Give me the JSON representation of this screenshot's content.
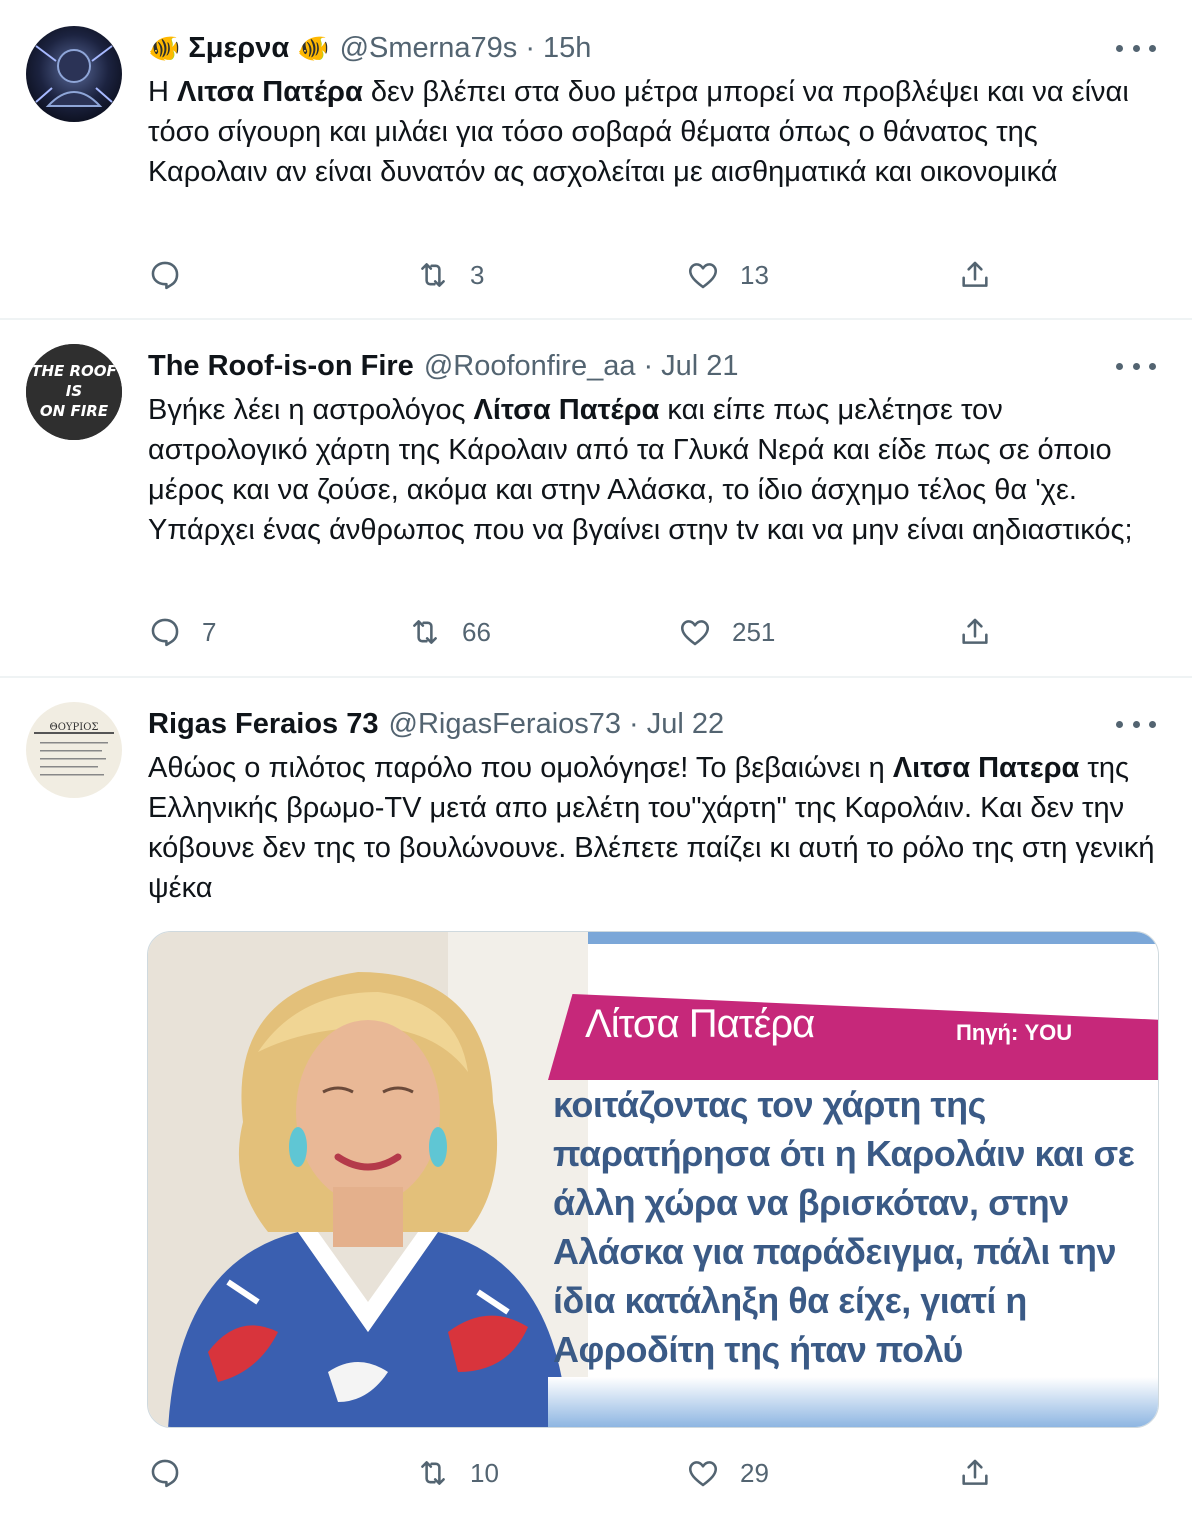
{
  "tweets": [
    {
      "name": "Σμερνα",
      "name_emoji": "🐠",
      "handle": "@Smerna79s",
      "separator": "·",
      "time": "15h",
      "text_parts": [
        "Η ",
        "Λιτσα Πατέρα",
        " δεν βλέπει στα δυο μέτρα μπορεί να προβλέψει και να είναι τόσο σίγουρη και μιλάει για τόσο σοβαρά θέματα όπως ο θάνατος της Καρολαιν αν είναι δυνατόν ας ασχολείται με αισθηματικά και οικονομικά"
      ],
      "replies": "",
      "retweets": "3",
      "likes": "13"
    },
    {
      "name": "The Roof-is-on Fire",
      "handle": "@Roofonfire_aa",
      "separator": "·",
      "time": "Jul 21",
      "avatar_text": [
        "THE ROOF",
        "IS",
        "ON FIRE"
      ],
      "text_parts": [
        "Βγήκε λέει η αστρολόγος ",
        "Λίτσα Πατέρα",
        " και είπε πως μελέτησε τον αστρολογικό χάρτη της Κάρολαιν από τα Γλυκά Νερά και είδε πως σε όποιο μέρος και να ζούσε, ακόμα και στην Αλάσκα, το ίδιο άσχημο τέλος θα 'χε. Υπάρχει ένας άνθρωπος που να βγαίνει στην tv και να μην είναι αηδιαστικός;"
      ],
      "replies": "7",
      "retweets": "66",
      "likes": "251"
    },
    {
      "name": "Rigas Feraios 73",
      "handle": "@RigasFeraios73",
      "separator": "·",
      "time": "Jul 22",
      "avatar_text": [
        "ΘΟΥΡΙΟΣ"
      ],
      "text_parts": [
        "Αθώος ο πιλότος παρόλο που ομολόγησε! Το βεβαιώνει η ",
        "Λιτσα Πατερα",
        " της Ελληνικής βρωμο-TV μετά απο μελέτη του\"χάρτη\" της Καρολάιν. Και δεν την κόβουνε δεν της το βουλώνουνε. Βλέπετε παίζει κι αυτή το ρόλο της στη γενική ψέκα"
      ],
      "media": {
        "title": "Λίτσα Πατέρα",
        "source": "Πηγή: YOU",
        "quote": "κοιτάζοντας τον χάρτη της παρατήρησα ότι η Καρολάιν και σε άλλη χώρα να βρισκόταν, στην Αλάσκα για παράδειγμα, πάλι την ίδια κατάληξη θα είχε, γιατί η Αφροδίτη της ήταν πολύ «χτυπημένη»."
      },
      "replies": "",
      "retweets": "10",
      "likes": "29"
    }
  ],
  "colors": {
    "text": "#0f1419",
    "secondary": "#536471",
    "divider": "#eff3f4",
    "magenta": "#c6287a",
    "quote_blue": "#3a5a86"
  },
  "icons": [
    "reply-icon",
    "retweet-icon",
    "like-icon",
    "share-icon",
    "more-icon"
  ]
}
